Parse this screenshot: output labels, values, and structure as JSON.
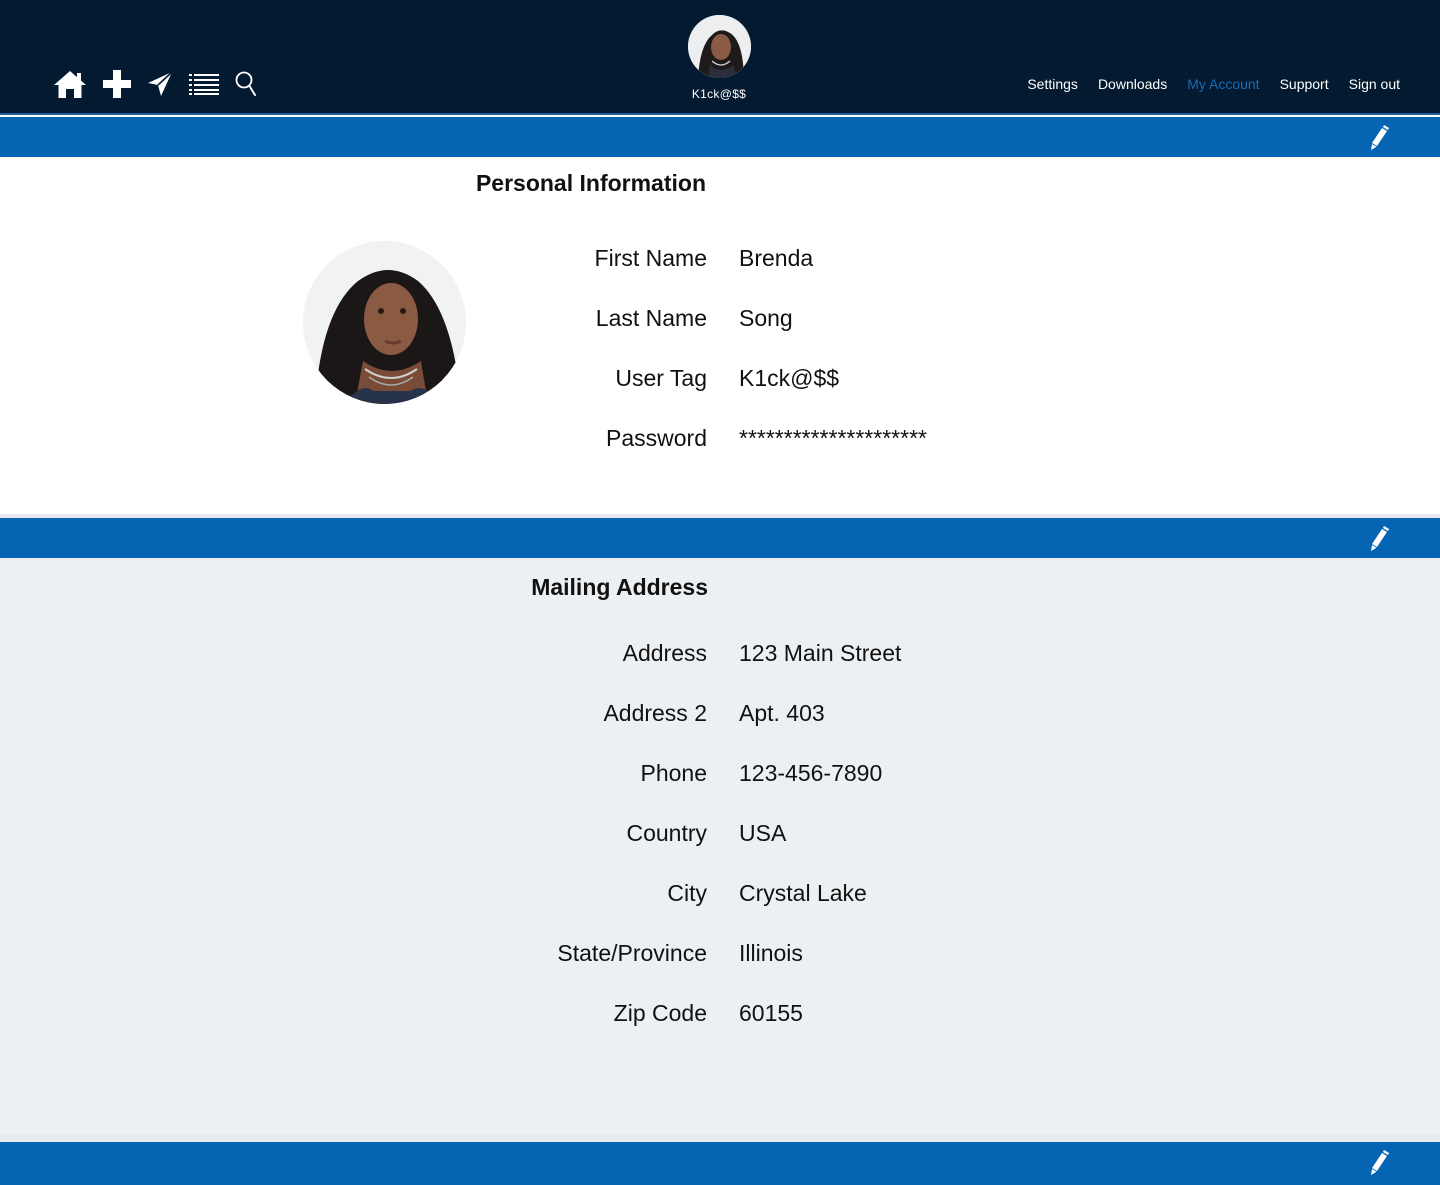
{
  "nav": {
    "icons": [
      "home-icon",
      "plus-icon",
      "send-icon",
      "list-icon",
      "search-icon"
    ],
    "user_tag": "K1ck@$$",
    "links": [
      {
        "label": "Settings",
        "active": false
      },
      {
        "label": "Downloads",
        "active": false
      },
      {
        "label": "My Account",
        "active": true
      },
      {
        "label": "Support",
        "active": false
      },
      {
        "label": "Sign out",
        "active": false
      }
    ]
  },
  "personal": {
    "title": "Personal Information",
    "first_name_label": "First Name",
    "first_name": "Brenda",
    "last_name_label": "Last Name",
    "last_name": "Song",
    "user_tag_label": "User Tag",
    "user_tag": "K1ck@$$",
    "password_label": "Password",
    "password": "*********************"
  },
  "mailing": {
    "title": "Mailing Address",
    "address_label": "Address",
    "address": "123 Main Street",
    "address2_label": "Address 2",
    "address2": "Apt. 403",
    "phone_label": "Phone",
    "phone": "123-456-7890",
    "country_label": "Country",
    "country": "USA",
    "city_label": "City",
    "city": "Crystal Lake",
    "state_label": "State/Province",
    "state": "Illinois",
    "zip_label": "Zip Code",
    "zip": "60155"
  },
  "colors": {
    "nav_bg": "#031a30",
    "accent_bar": "#0565b3",
    "active_link": "#1a6bb5",
    "panel_grey": "#edf0f3"
  }
}
